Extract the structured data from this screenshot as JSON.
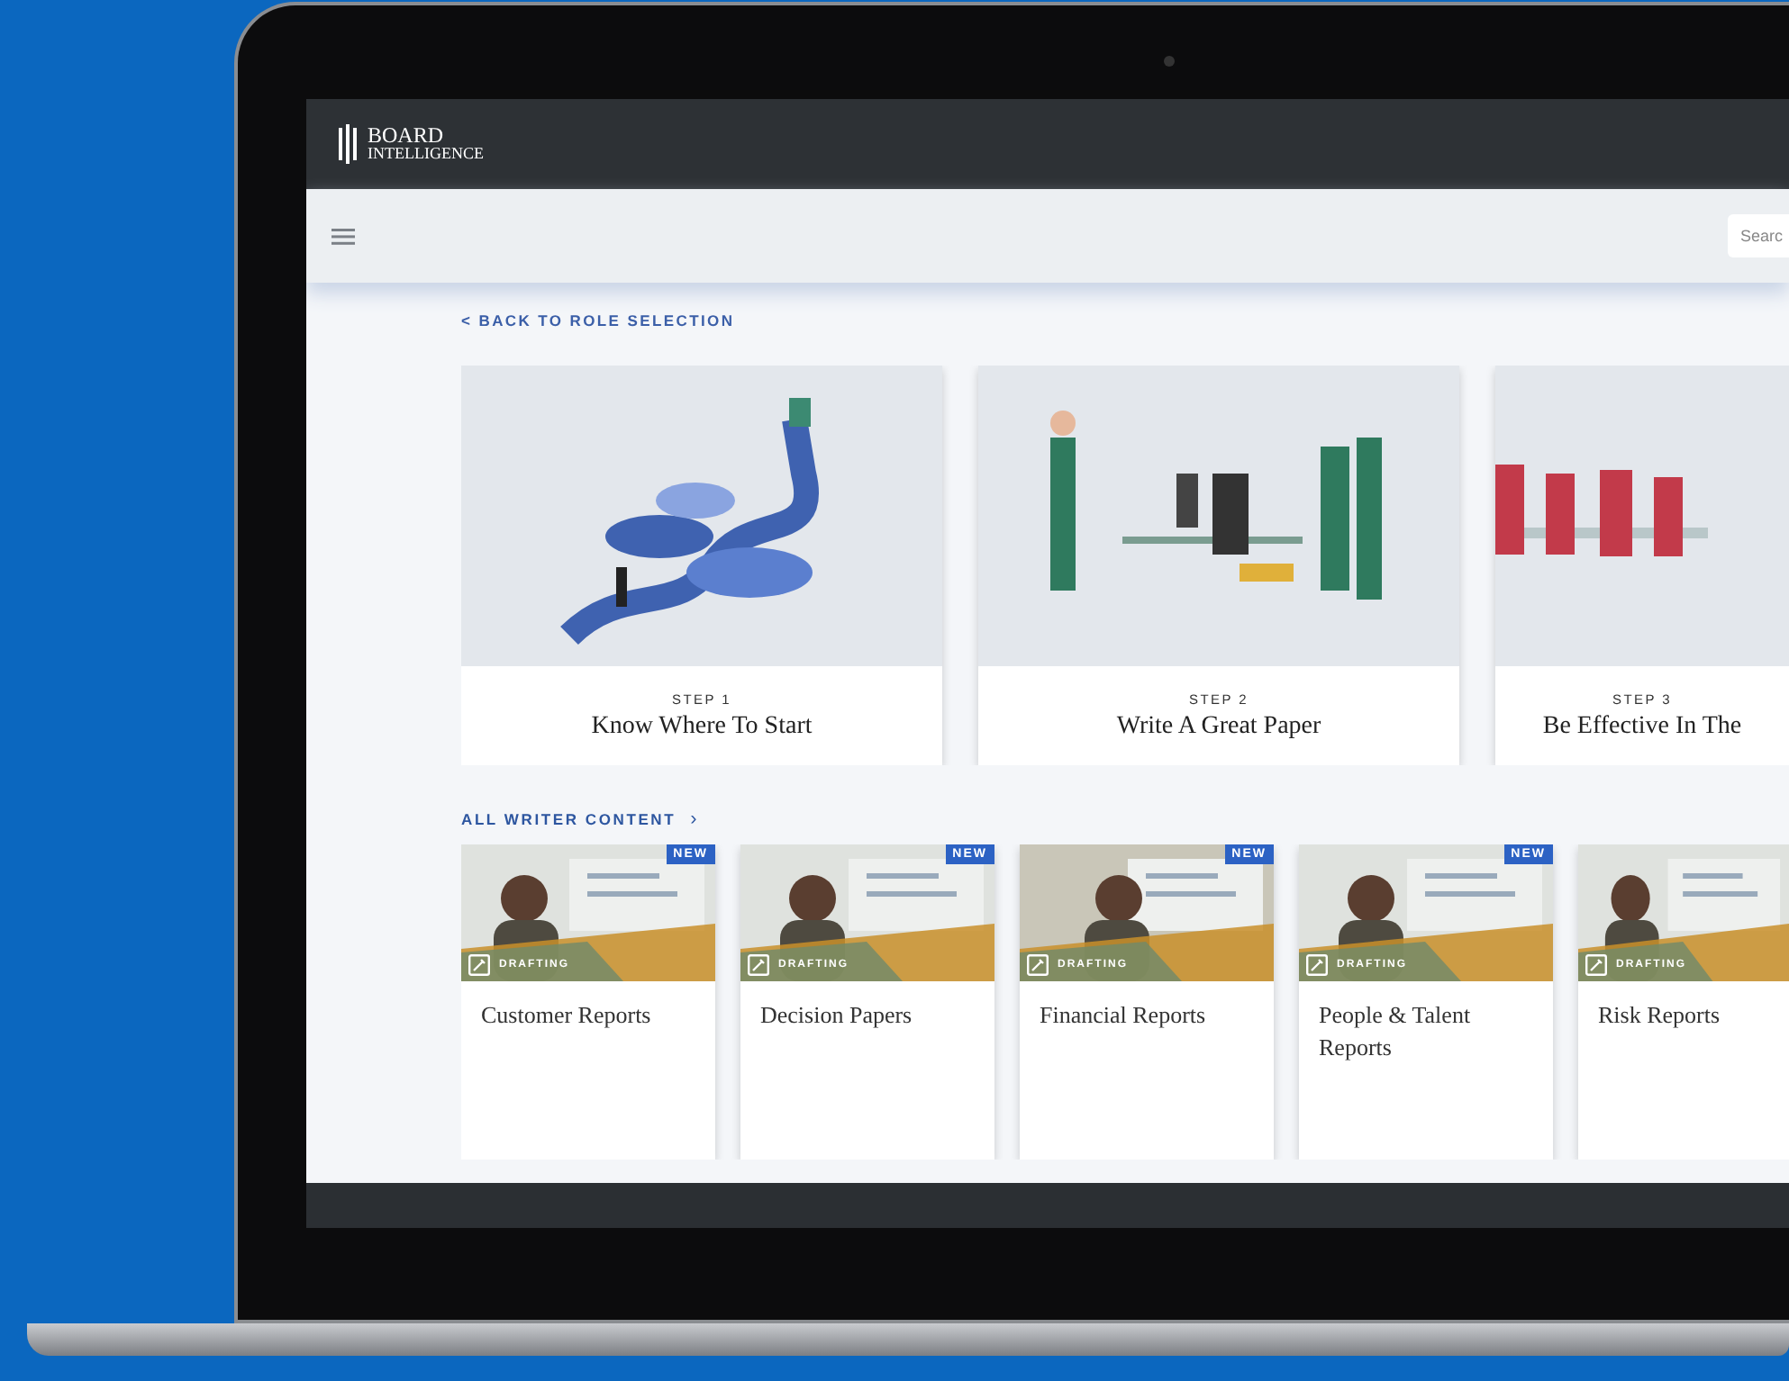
{
  "header": {
    "logo": [
      "BOARD",
      "INTELLIGENCE"
    ]
  },
  "toolbar": {
    "search": {
      "placeholder": "Searc"
    }
  },
  "back_link": "< BACK TO ROLE SELECTION",
  "steps": [
    {
      "step": "STEP 1",
      "title": "Know Where To Start"
    },
    {
      "step": "STEP 2",
      "title": "Write A Great Paper"
    },
    {
      "step": "STEP 3",
      "title": "Be Effective In The"
    }
  ],
  "section": {
    "title": "ALL WRITER CONTENT",
    "chevron": "›"
  },
  "content_cards": [
    {
      "title": "Customer Reports",
      "tag": "DRAFTING",
      "badge": "NEW"
    },
    {
      "title": "Decision Papers",
      "tag": "DRAFTING",
      "badge": "NEW"
    },
    {
      "title": "Financial Reports",
      "tag": "DRAFTING",
      "badge": "NEW"
    },
    {
      "title": "People & Talent Reports",
      "tag": "DRAFTING",
      "badge": "NEW"
    },
    {
      "title": "Risk Reports",
      "tag": "DRAFTING"
    }
  ]
}
